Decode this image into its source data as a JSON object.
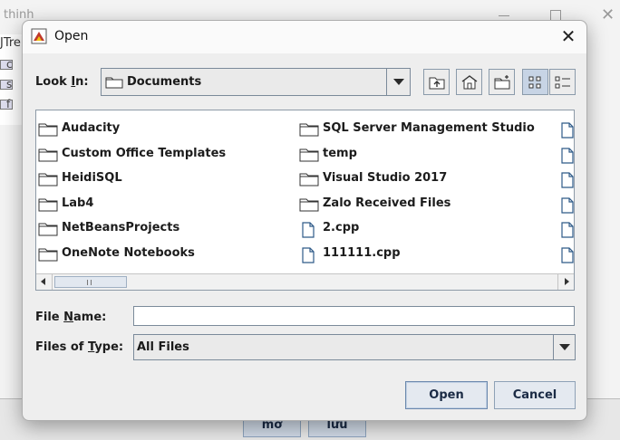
{
  "background_app": {
    "title": "thinh",
    "tree_label": "JTre",
    "tree_letters": [
      "c",
      "s",
      "f"
    ],
    "buttons": [
      "mở",
      "lưu"
    ]
  },
  "dialog": {
    "title": "Open",
    "look_in": {
      "label_pre": "Look ",
      "label_mnemonic": "I",
      "label_post": "n:",
      "value": "Documents"
    },
    "toolbar": {
      "buttons": [
        "up-one-level",
        "home",
        "create-new-folder",
        "list-view",
        "details-view"
      ],
      "selected": "list-view"
    },
    "files": [
      {
        "name": "Audacity",
        "type": "folder"
      },
      {
        "name": "Custom Office Templates",
        "type": "folder"
      },
      {
        "name": "HeidiSQL",
        "type": "folder"
      },
      {
        "name": "Lab4",
        "type": "folder"
      },
      {
        "name": "NetBeansProjects",
        "type": "folder"
      },
      {
        "name": "OneNote Notebooks",
        "type": "folder"
      },
      {
        "name": "SQL Server Management Studio",
        "type": "folder"
      },
      {
        "name": "temp",
        "type": "folder"
      },
      {
        "name": "Visual Studio 2017",
        "type": "folder"
      },
      {
        "name": "Zalo Received Files",
        "type": "folder"
      },
      {
        "name": "2.cpp",
        "type": "file"
      },
      {
        "name": "111111.cpp",
        "type": "file"
      }
    ],
    "file_name": {
      "label_pre": "File ",
      "label_mnemonic": "N",
      "label_post": "ame:",
      "value": ""
    },
    "files_of_type": {
      "label_pre": "Files of ",
      "label_mnemonic": "T",
      "label_post": "ype:",
      "value": "All Files"
    },
    "open_label": "Open",
    "cancel_label": "Cancel"
  }
}
